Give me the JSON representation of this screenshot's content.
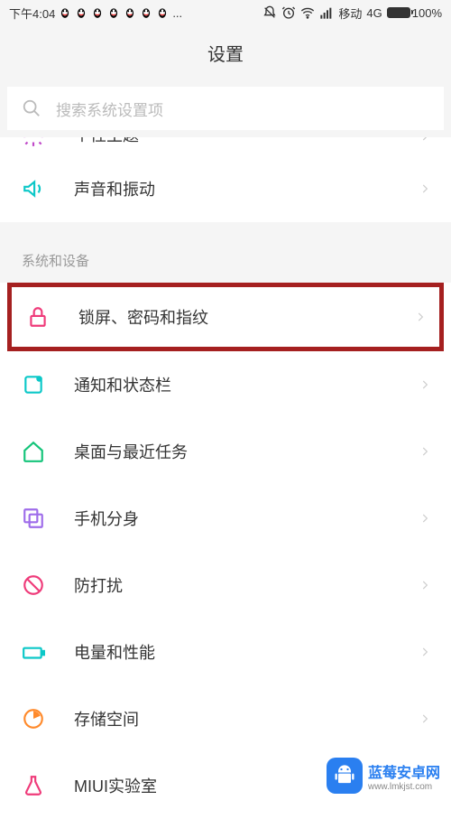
{
  "status": {
    "time": "下午4:04",
    "dots": "...",
    "carrier": "移动",
    "network": "4G",
    "battery_pct": "100%"
  },
  "header": {
    "title": "设置"
  },
  "search": {
    "placeholder": "搜索系统设置项"
  },
  "partial": {
    "label": "个性主题"
  },
  "group1": {
    "sound": "声音和振动"
  },
  "section_sys": {
    "title": "系统和设备"
  },
  "rows": {
    "lock": "锁屏、密码和指纹",
    "notif": "通知和状态栏",
    "home": "桌面与最近任务",
    "dual": "手机分身",
    "dnd": "防打扰",
    "power": "电量和性能",
    "storage": "存储空间",
    "miui": "MIUI实验室"
  },
  "watermark": {
    "main": "蓝莓安卓网",
    "sub": "www.lmkjst.com"
  }
}
